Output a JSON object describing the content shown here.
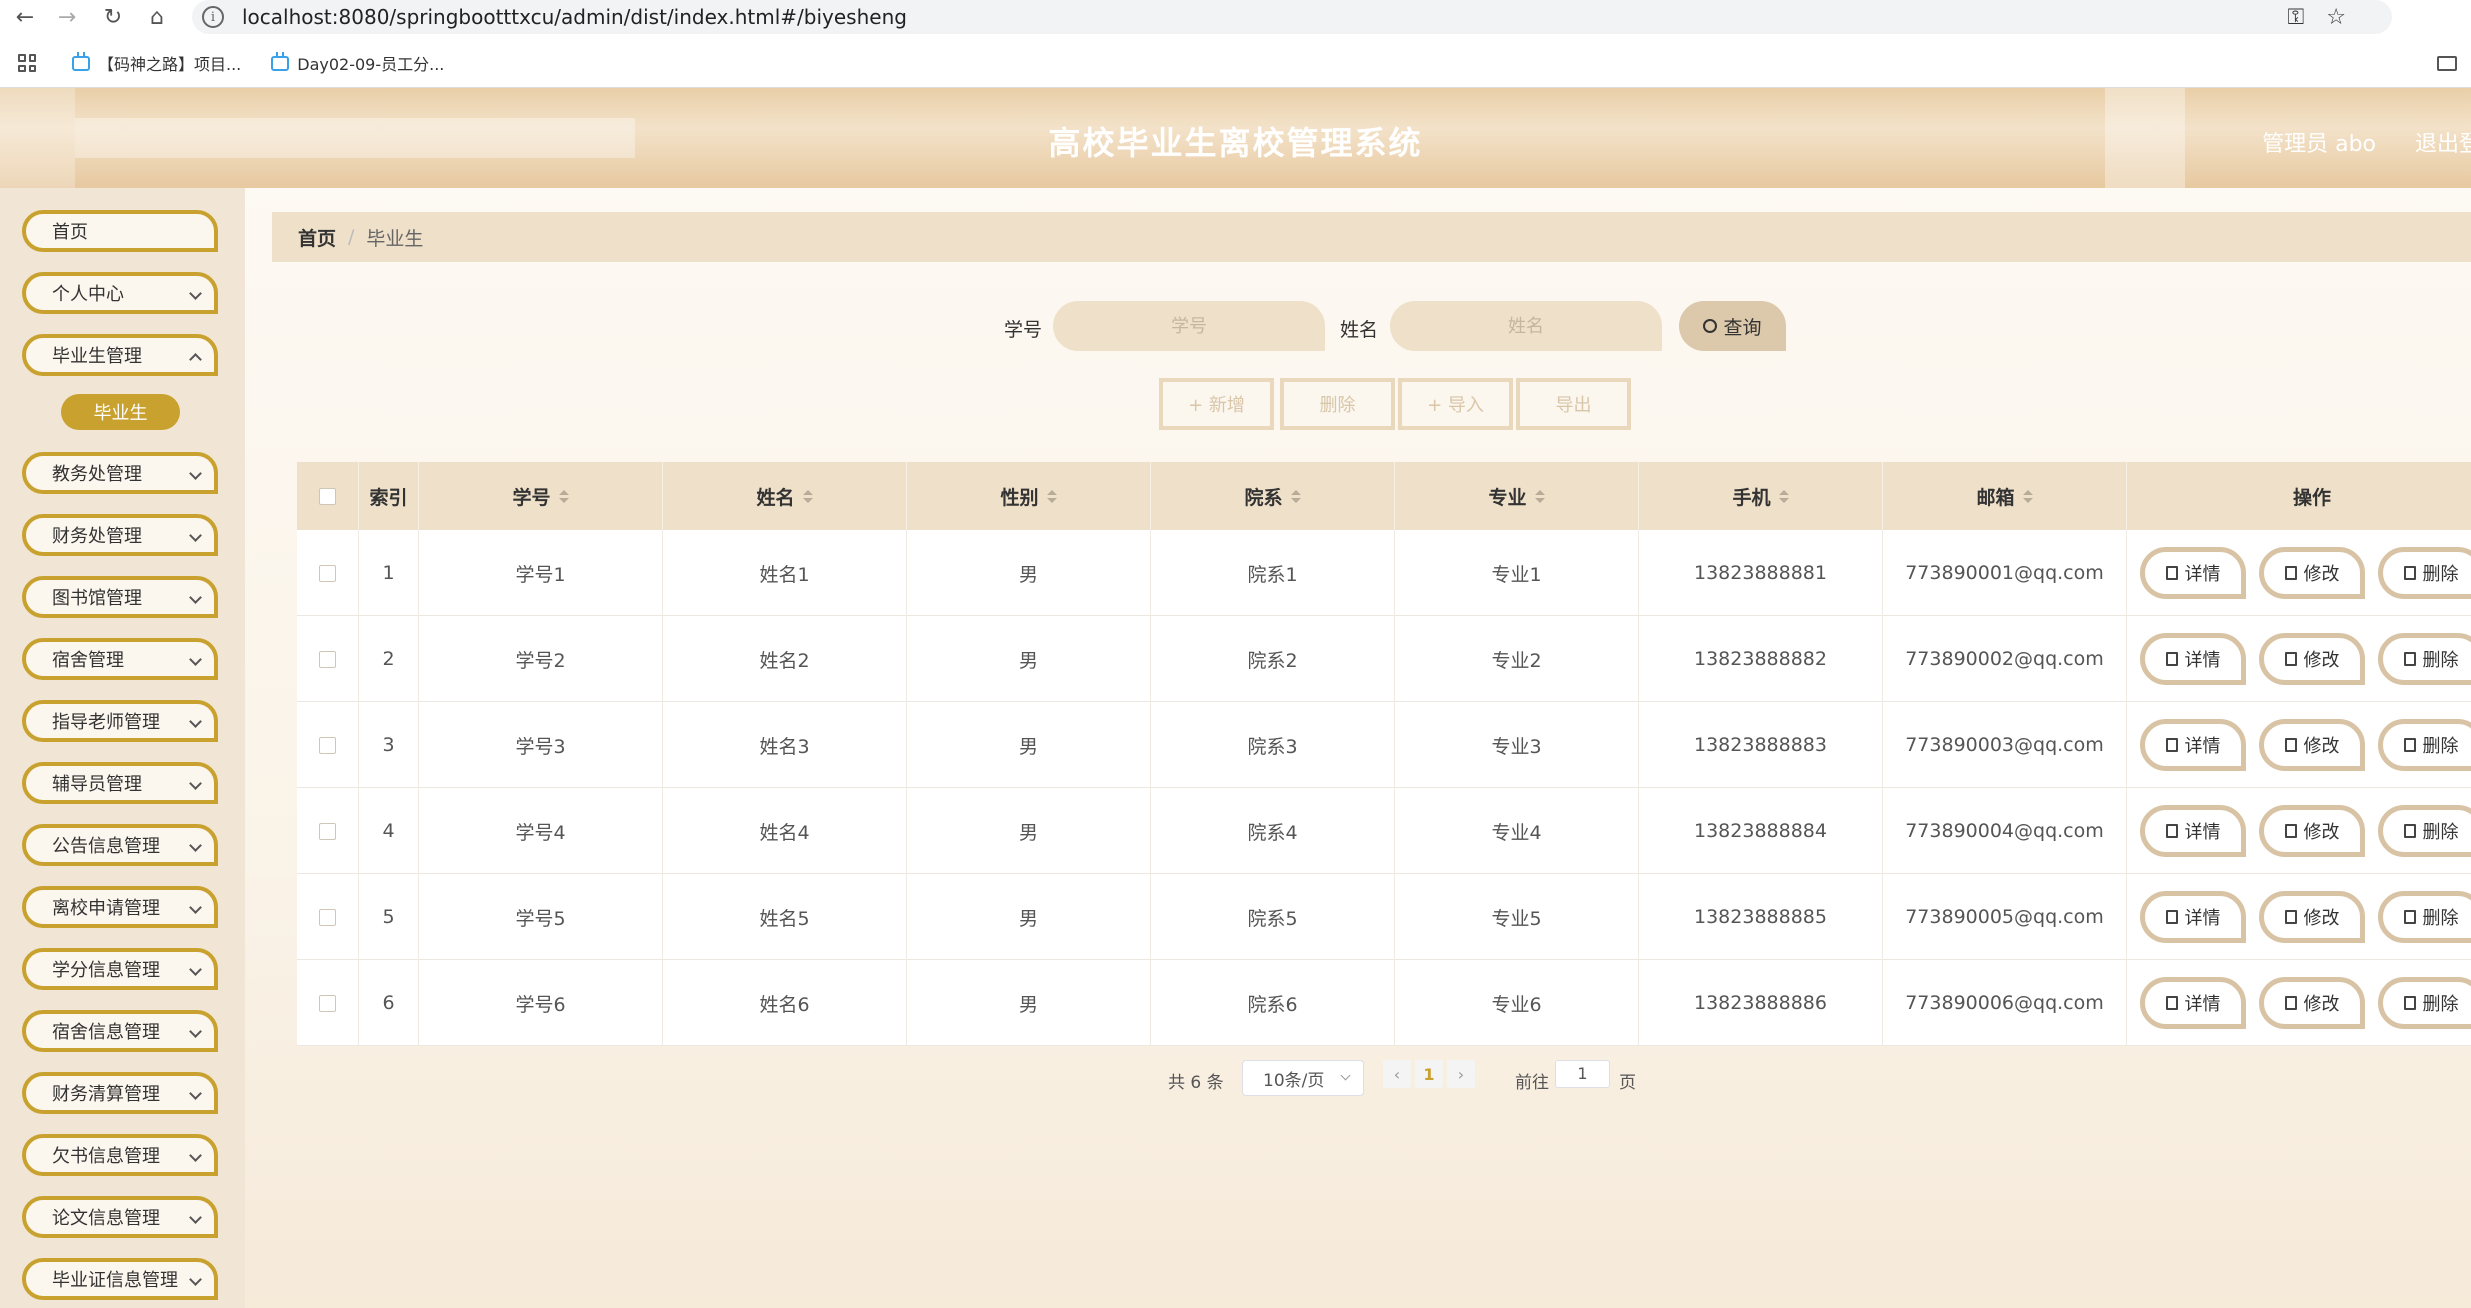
{
  "browser": {
    "url": "localhost:8080/springbootttxcu/admin/dist/index.html#/biyesheng",
    "bookmarks": [
      "【码神之路】项目...",
      "Day02-09-员工分..."
    ]
  },
  "header": {
    "title": "高校毕业生离校管理系统",
    "admin_label": "管理员 abo",
    "logout_label": "退出登"
  },
  "sidebar": {
    "items": [
      {
        "label": "首页"
      },
      {
        "label": "个人中心"
      },
      {
        "label": "毕业生管理"
      },
      {
        "label": "教务处管理"
      },
      {
        "label": "财务处管理"
      },
      {
        "label": "图书馆管理"
      },
      {
        "label": "宿舍管理"
      },
      {
        "label": "指导老师管理"
      },
      {
        "label": "辅导员管理"
      },
      {
        "label": "公告信息管理"
      },
      {
        "label": "离校申请管理"
      },
      {
        "label": "学分信息管理"
      },
      {
        "label": "宿舍信息管理"
      },
      {
        "label": "财务清算管理"
      },
      {
        "label": "欠书信息管理"
      },
      {
        "label": "论文信息管理"
      },
      {
        "label": "毕业证信息管理"
      }
    ],
    "active_sub": "毕业生"
  },
  "breadcrumb": {
    "home": "首页",
    "current": "毕业生"
  },
  "search": {
    "student_id_label": "学号",
    "student_id_placeholder": "学号",
    "name_label": "姓名",
    "name_placeholder": "姓名",
    "query_button": "查询"
  },
  "actions": {
    "add": "+ 新增",
    "delete": "删除",
    "import": "+ 导入",
    "export": "导出"
  },
  "table": {
    "columns": [
      "索引",
      "学号",
      "姓名",
      "性别",
      "院系",
      "专业",
      "手机",
      "邮箱",
      "操作"
    ],
    "rows": [
      {
        "index": "1",
        "student_id": "学号1",
        "name": "姓名1",
        "gender": "男",
        "department": "院系1",
        "major": "专业1",
        "phone": "13823888881",
        "email": "773890001@qq.com"
      },
      {
        "index": "2",
        "student_id": "学号2",
        "name": "姓名2",
        "gender": "男",
        "department": "院系2",
        "major": "专业2",
        "phone": "13823888882",
        "email": "773890002@qq.com"
      },
      {
        "index": "3",
        "student_id": "学号3",
        "name": "姓名3",
        "gender": "男",
        "department": "院系3",
        "major": "专业3",
        "phone": "13823888883",
        "email": "773890003@qq.com"
      },
      {
        "index": "4",
        "student_id": "学号4",
        "name": "姓名4",
        "gender": "男",
        "department": "院系4",
        "major": "专业4",
        "phone": "13823888884",
        "email": "773890004@qq.com"
      },
      {
        "index": "5",
        "student_id": "学号5",
        "name": "姓名5",
        "gender": "男",
        "department": "院系5",
        "major": "专业5",
        "phone": "13823888885",
        "email": "773890005@qq.com"
      },
      {
        "index": "6",
        "student_id": "学号6",
        "name": "姓名6",
        "gender": "男",
        "department": "院系6",
        "major": "专业6",
        "phone": "13823888886",
        "email": "773890006@qq.com"
      }
    ],
    "row_actions": {
      "detail": "详情",
      "edit": "修改",
      "delete": "删除"
    }
  },
  "pagination": {
    "total": "共 6 条",
    "page_size": "10条/页",
    "current_page": "1",
    "goto_label": "前往",
    "goto_value": "1",
    "goto_unit": "页"
  },
  "colors": {
    "accent": "#c9a12e",
    "header_bg": "#efe0c9",
    "sidebar_bg": "#f1e6d6"
  }
}
